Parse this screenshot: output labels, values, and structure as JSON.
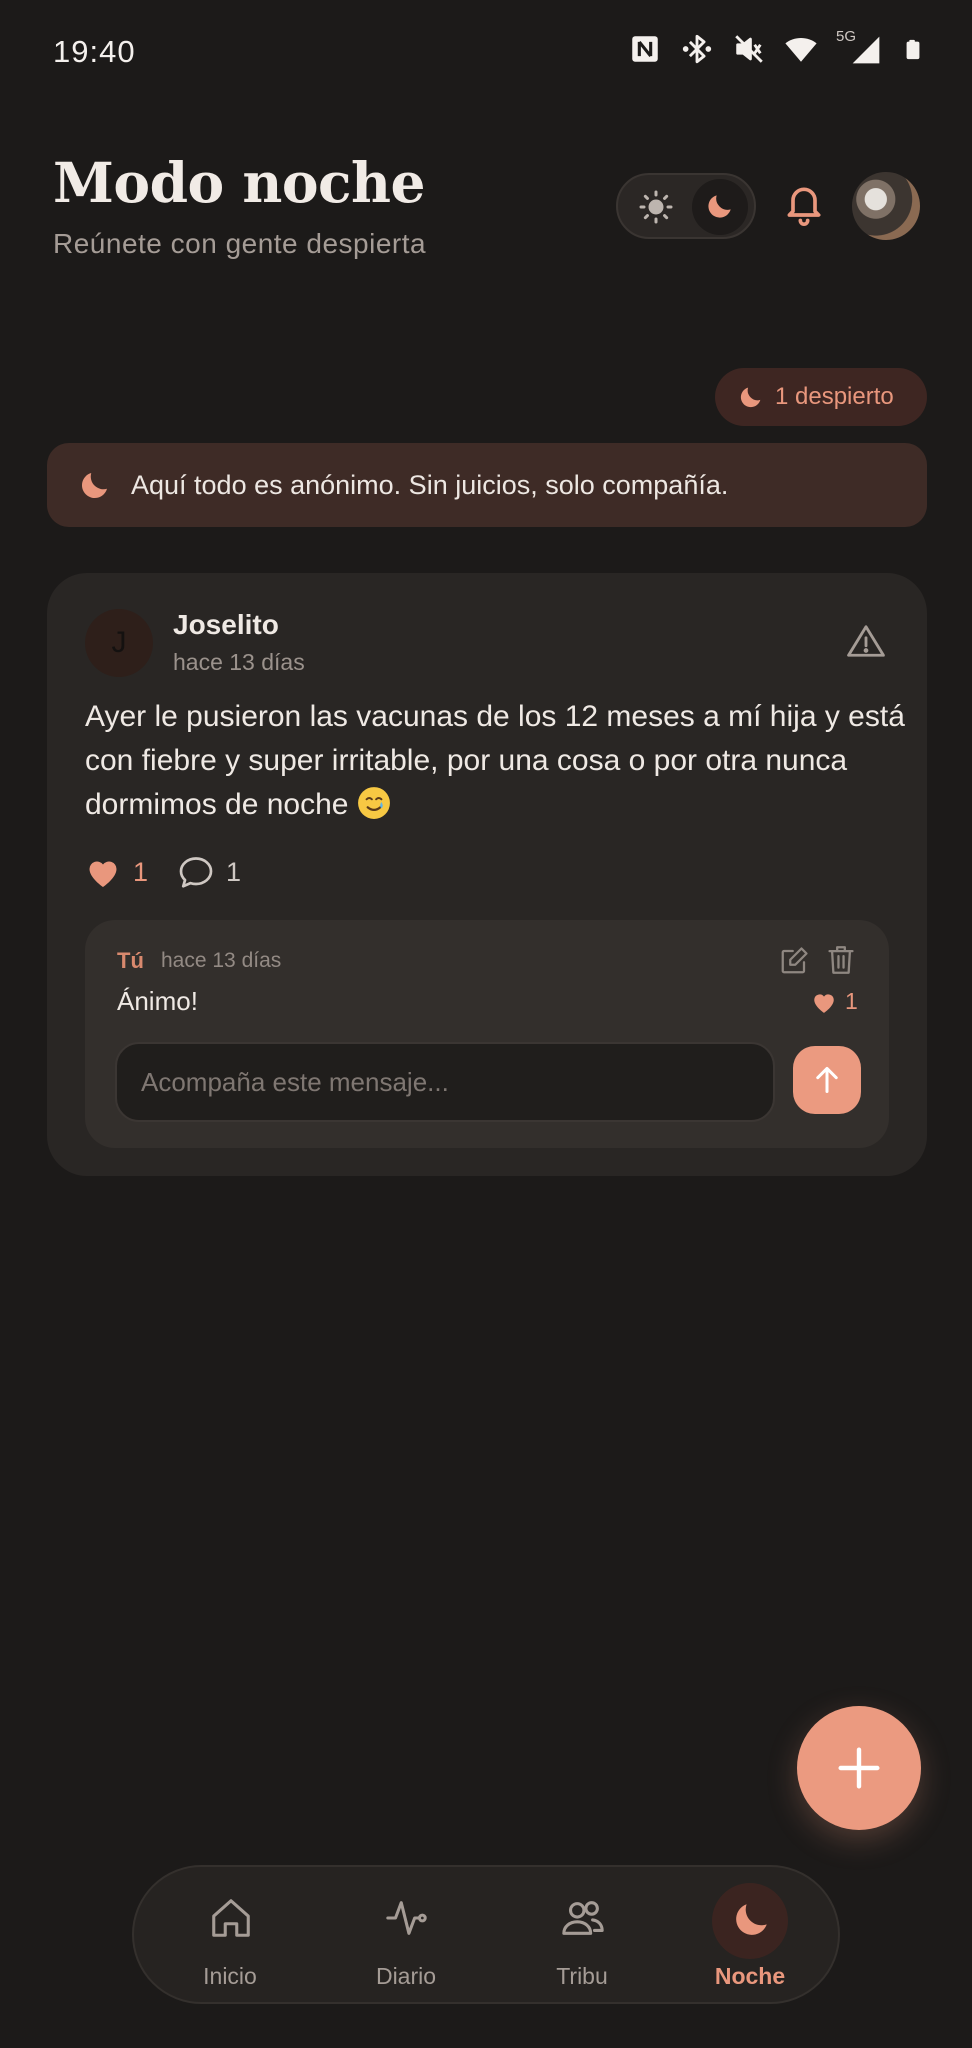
{
  "status_bar": {
    "time": "19:40",
    "network_label": "5G",
    "icons": [
      "nfc-icon",
      "bluetooth-icon",
      "mute-icon",
      "wifi-icon",
      "signal-icon",
      "battery-icon"
    ]
  },
  "header": {
    "title": "Modo noche",
    "subtitle": "Reúnete con gente despierta",
    "theme_toggle": {
      "options": [
        "light",
        "dark"
      ],
      "selected": "dark"
    }
  },
  "awake_badge": {
    "label": "1 despierto"
  },
  "banner": {
    "text": "Aquí todo es anónimo. Sin juicios, solo compañía."
  },
  "post": {
    "avatar_initial": "J",
    "author": "Joselito",
    "time": "hace 13 días",
    "body": "Ayer le pusieron las vacunas de los 12 meses a mí hija y está con fiebre y super irritable, por una cosa o por otra nunca dormimos de noche",
    "emoji": "smiling-face-with-tear",
    "like_count": "1",
    "comment_count": "1",
    "comment": {
      "author": "Tú",
      "time": "hace 13 días",
      "text": "Ánimo!",
      "like_count": "1"
    },
    "reply_placeholder": "Acompaña este mensaje..."
  },
  "nav": {
    "items": [
      {
        "label": "Inicio",
        "icon": "home-icon"
      },
      {
        "label": "Diario",
        "icon": "pulse-icon"
      },
      {
        "label": "Tribu",
        "icon": "users-icon"
      },
      {
        "label": "Noche",
        "icon": "moon-icon"
      }
    ],
    "active": "Noche"
  },
  "colors": {
    "background": "#1c1a19",
    "card": "#292624",
    "accent": "#e9977d",
    "banner": "#3e2b26",
    "text": "#efe9e4",
    "muted": "#a59c96"
  }
}
